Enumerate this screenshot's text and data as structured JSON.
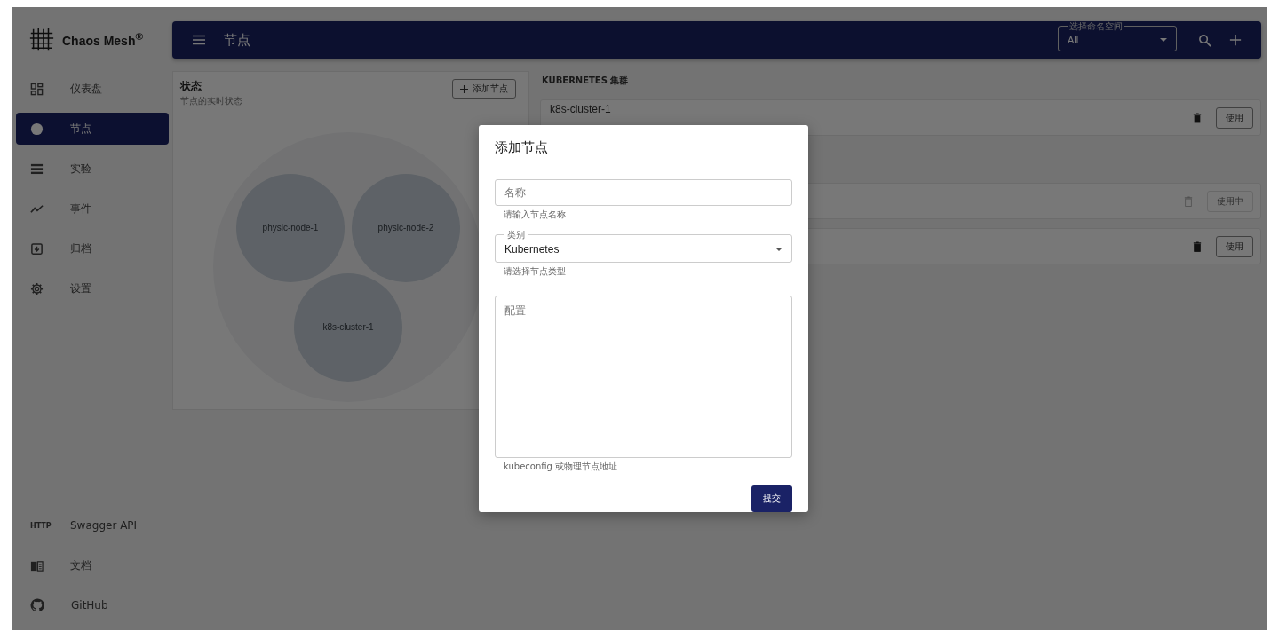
{
  "brand": {
    "name": "Chaos Mesh$^{®}$"
  },
  "sidebar": {
    "items": [
      {
        "label": "仪表盘",
        "selected": false
      },
      {
        "label": "节点",
        "selected": true
      },
      {
        "label": "实验",
        "selected": false
      },
      {
        "label": "事件",
        "selected": false
      },
      {
        "label": "归档",
        "selected": false
      },
      {
        "label": "设置",
        "selected": false
      }
    ],
    "footer": [
      {
        "label": "Swagger API",
        "icon_text": "HTTP"
      },
      {
        "label": "文档"
      },
      {
        "label": "GitHub"
      }
    ]
  },
  "header": {
    "title": "节点",
    "namespace": {
      "label": "选择命名空间",
      "value": "All"
    }
  },
  "status_card": {
    "title": "状态",
    "subtitle": "节点的实时状态",
    "add_button": "添加节点",
    "bubbles": [
      {
        "label": "physic-node-1"
      },
      {
        "label": "physic-node-2"
      },
      {
        "label": "k8s-cluster-1"
      }
    ]
  },
  "clusters": {
    "heading": "KUBERNETES 集群",
    "items": [
      {
        "name": "k8s-cluster-1",
        "action": "使用",
        "disabled": false
      }
    ]
  },
  "physical_nodes": {
    "items": [
      {
        "action": "使用中",
        "disabled": true
      },
      {
        "action": "使用",
        "disabled": false
      }
    ]
  },
  "dialog": {
    "title": "添加节点",
    "name_field": {
      "placeholder": "名称",
      "helper": "请输入节点名称"
    },
    "type_field": {
      "label": "类别",
      "value": "Kubernetes",
      "helper": "请选择节点类型"
    },
    "config_field": {
      "placeholder": "配置",
      "helper": "kubeconfig 或物理节点地址"
    },
    "submit": "提交"
  }
}
